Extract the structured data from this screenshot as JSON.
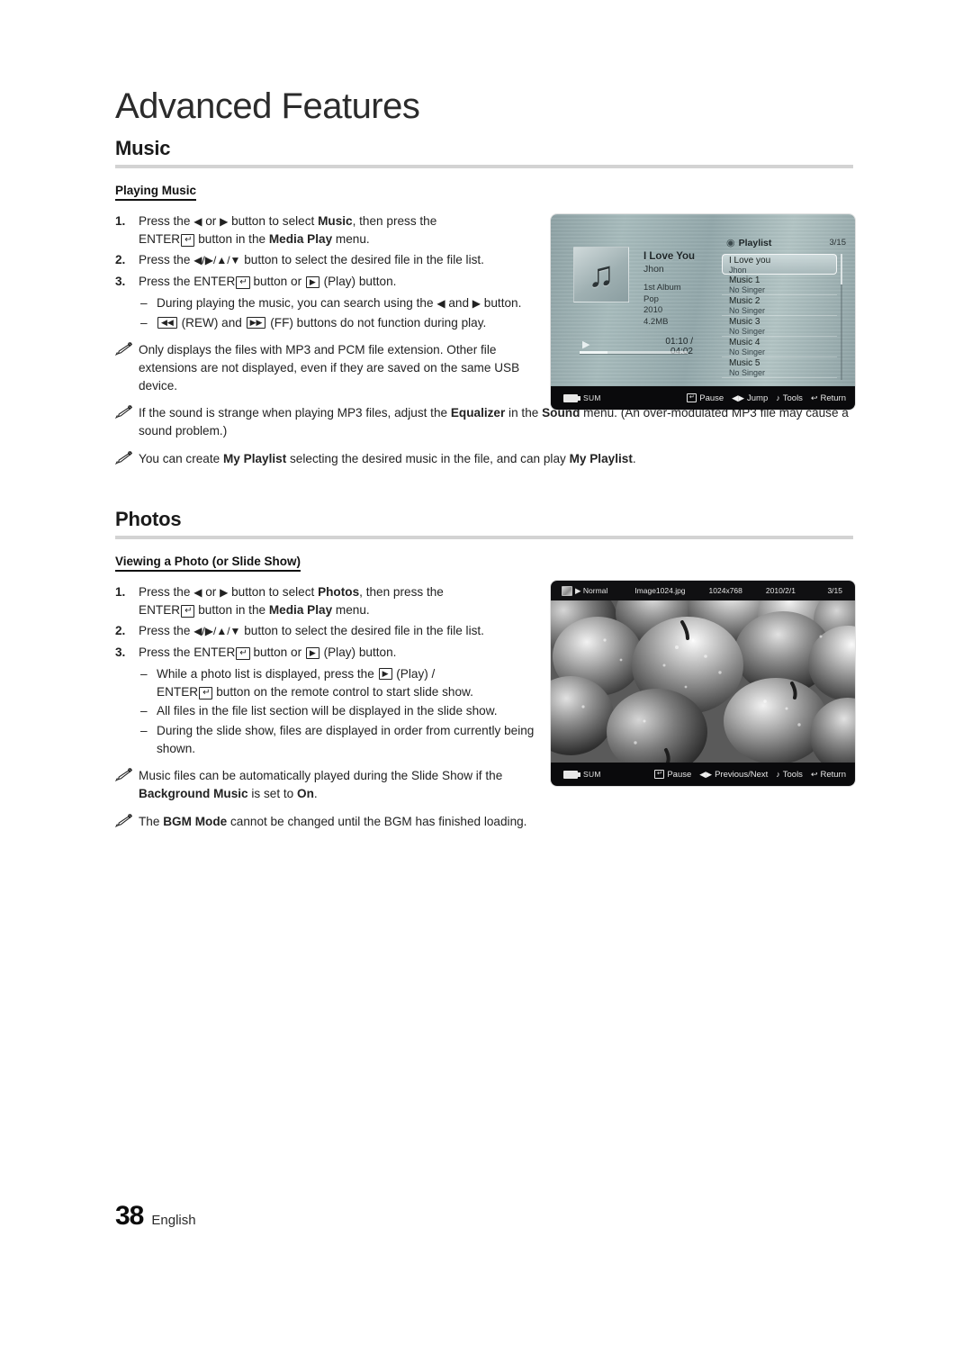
{
  "chapter": {
    "title": "Advanced Features"
  },
  "footer": {
    "page_number": "38",
    "language": "English"
  },
  "music_section": {
    "heading": "Music",
    "sub_heading": "Playing Music",
    "steps": [
      {
        "num": "1.",
        "parts": [
          {
            "t": "Press the ",
            "b": false
          },
          {
            "t": "◀",
            "b": false
          },
          {
            "t": " or ",
            "b": false
          },
          {
            "t": "▶",
            "b": false
          },
          {
            "t": " button to select ",
            "b": false
          },
          {
            "t": "Music",
            "b": true
          },
          {
            "t": ", then press the ENTER",
            "b": false
          },
          {
            "t": "E",
            "b": false
          },
          {
            "t": " button in the ",
            "b": false
          },
          {
            "t": "Media Play",
            "b": true
          },
          {
            "t": " menu.",
            "b": false
          }
        ],
        "text": "Press the ◀ or ▶ button to select Music, then press the ENTER button in the Media Play menu."
      },
      {
        "num": "2.",
        "text": "Press the ◀/▶/▲/▼ button to select the desired file in the file list."
      },
      {
        "num": "3.",
        "text": "Press the ENTER button or (Play) button."
      }
    ],
    "dashes": [
      "During playing the music, you can search using the ◀ and ▶ button.",
      "(REW) and (FF) buttons do not function during play."
    ],
    "notes": [
      "Only displays the files with MP3 and PCM file extension. Other file extensions are not displayed, even if they are saved on the same USB device.",
      "If the sound is strange when playing MP3 files, adjust the Equalizer in the Sound menu. (An over-modulated MP3 file may cause a sound problem.)",
      "You can create My Playlist selecting the desired music in the file, and can play My Playlist."
    ]
  },
  "photos_section": {
    "heading": "Photos",
    "sub_heading": "Viewing a Photo (or Slide Show)",
    "steps": [
      {
        "num": "1.",
        "text": "Press the ◀ or ▶ button to select Photos, then press the ENTER button in the Media Play menu."
      },
      {
        "num": "2.",
        "text": "Press the ◀/▶/▲/▼ button to select the desired file in the file list."
      },
      {
        "num": "3.",
        "text": "Press the ENTER button or (Play) button."
      }
    ],
    "dashes": [
      "While a photo list is displayed, press the (Play) / ENTER button on the remote control to start slide show.",
      "All files in the file list section will be displayed in the slide show.",
      "During the slide show, files are displayed in order from currently being shown."
    ],
    "notes": [
      "Music files can be automatically played during the Slide Show if the Background Music is set to On.",
      "The BGM Mode cannot be changed until the BGM has finished loading."
    ]
  },
  "music_screenshot": {
    "now_playing": {
      "title": "I Love You",
      "artist": "Jhon",
      "album": "1st Album",
      "genre": "Pop",
      "year": "2010",
      "size": "4.2MB",
      "time": "01:10 / 04:02"
    },
    "playlist": {
      "label": "Playlist",
      "count": "3/15",
      "items": [
        {
          "name": "I Love you",
          "singer": "Jhon",
          "selected": true
        },
        {
          "name": "Music 1",
          "singer": "No Singer",
          "selected": false
        },
        {
          "name": "Music 2",
          "singer": "No Singer",
          "selected": false
        },
        {
          "name": "Music 3",
          "singer": "No Singer",
          "selected": false
        },
        {
          "name": "Music 4",
          "singer": "No Singer",
          "selected": false
        },
        {
          "name": "Music 5",
          "singer": "No Singer",
          "selected": false
        }
      ]
    },
    "bottom_bar": {
      "source": "SUM",
      "actions": [
        {
          "glyph": "enter",
          "label": "Pause"
        },
        {
          "glyph": "◀▶",
          "label": "Jump"
        },
        {
          "glyph": "tools",
          "label": "Tools"
        },
        {
          "glyph": "↶",
          "label": "Return"
        }
      ]
    }
  },
  "photo_screenshot": {
    "top_bar": {
      "mode": "▶ Normal",
      "filename": "Image1024.jpg",
      "resolution": "1024x768",
      "date": "2010/2/1",
      "count": "3/15"
    },
    "bottom_bar": {
      "source": "SUM",
      "actions": [
        {
          "glyph": "enter",
          "label": "Pause"
        },
        {
          "glyph": "◀▶",
          "label": "Previous/Next"
        },
        {
          "glyph": "tools",
          "label": "Tools"
        },
        {
          "glyph": "↶",
          "label": "Return"
        }
      ]
    }
  },
  "colors": {
    "rule": "#d3d3d3",
    "text": "#222222",
    "bar_bg": "#0a0a0c"
  }
}
